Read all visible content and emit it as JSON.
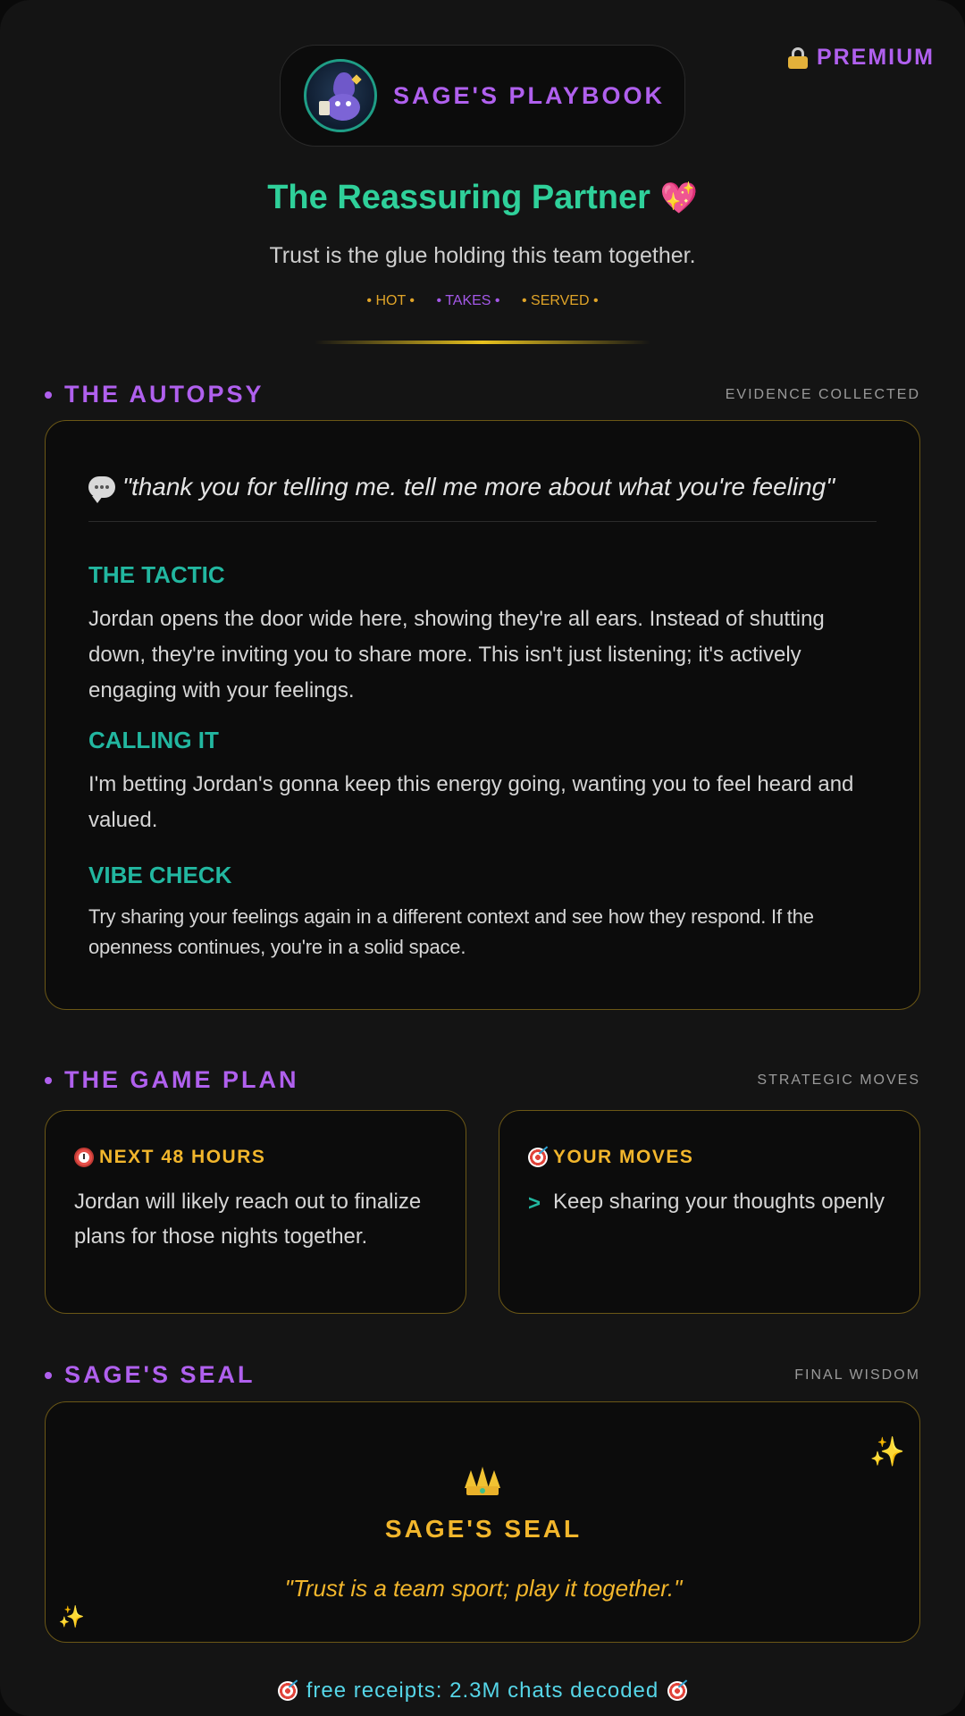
{
  "header": {
    "premium_label": "PREMIUM",
    "brand_title": "SAGE'S PLAYBOOK",
    "persona_title": "The Reassuring Partner",
    "persona_emoji": "💖",
    "persona_subtitle": "Trust is the glue holding this team together.",
    "tags": [
      "• HOT •",
      "• TAKES •",
      "• SERVED •"
    ]
  },
  "autopsy": {
    "title": "THE AUTOPSY",
    "right_label": "EVIDENCE COLLECTED",
    "quote": "\"thank you for telling me. tell me more about what you're feeling\"",
    "tactic_label": "THE TACTIC",
    "tactic_text": "Jordan opens the door wide here, showing they're all ears. Instead of shutting down, they're inviting you to share more. This isn't just listening; it's actively engaging with your feelings.",
    "calling_label": "CALLING IT",
    "calling_text": "I'm betting Jordan's gonna keep this energy going, wanting you to feel heard and valued.",
    "vibe_label": "VIBE CHECK",
    "vibe_text": "Try sharing your feelings again in a different context and see how they respond. If the openness continues, you're in a solid space."
  },
  "game_plan": {
    "title": "THE GAME PLAN",
    "right_label": "STRATEGIC MOVES",
    "next_label": "NEXT 48 HOURS",
    "next_text": "Jordan will likely reach out to finalize plans for those nights together.",
    "moves_label": "YOUR MOVES",
    "moves": [
      "Keep sharing your thoughts openly"
    ]
  },
  "seal": {
    "title": "SAGE'S SEAL",
    "right_label": "FINAL WISDOM",
    "card_title": "SAGE'S SEAL",
    "quote": "\"Trust is a team sport; play it together.\""
  },
  "footer": {
    "text": "free receipts: 2.3M chats decoded"
  },
  "colors": {
    "accent_purple": "#b060ee",
    "accent_green": "#2fd09a",
    "accent_teal": "#22b7a0",
    "accent_gold": "#f2b62c",
    "footer_cyan": "#56d6e8"
  }
}
